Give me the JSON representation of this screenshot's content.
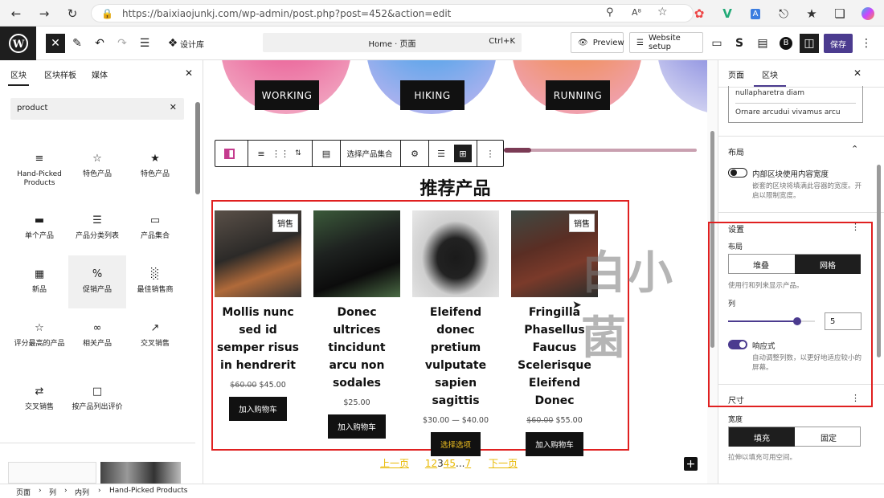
{
  "browser": {
    "url": "https://baixiaojunkj.com/wp-admin/post.php?post=452&action=edit"
  },
  "toolbar": {
    "design_label": "设计库",
    "command_title": "Home · 页面",
    "command_shortcut": "Ctrl+K",
    "preview_label": "Preview",
    "website_setup_label": "Website setup",
    "save_label": "保存"
  },
  "left_panel": {
    "tabs": [
      "区块",
      "区块样板",
      "媒体"
    ],
    "search_value": "product",
    "blocks": [
      {
        "label": "Hand-Picked Products",
        "icon": "list-icon"
      },
      {
        "label": "特色产品",
        "icon": "star-outline-icon"
      },
      {
        "label": "特色产品",
        "icon": "star-filled-icon"
      },
      {
        "label": "单个产品",
        "icon": "single-product-icon"
      },
      {
        "label": "产品分类列表",
        "icon": "category-list-icon"
      },
      {
        "label": "产品集合",
        "icon": "collection-icon"
      },
      {
        "label": "新品",
        "icon": "calendar-icon"
      },
      {
        "label": "促销产品",
        "icon": "percent-icon"
      },
      {
        "label": "最佳销售商",
        "icon": "bar-chart-icon"
      },
      {
        "label": "评分最高的产品",
        "icon": "star-outline-icon"
      },
      {
        "label": "相关产品",
        "icon": "link-icon"
      },
      {
        "label": "交叉销售",
        "icon": "trending-icon"
      },
      {
        "label": "交叉销售",
        "icon": "repeat-icon"
      },
      {
        "label": "按产品列出评价",
        "icon": "comment-icon"
      }
    ]
  },
  "canvas": {
    "categories": [
      "WORKING",
      "HIKING",
      "RUNNING"
    ],
    "toolbar_select_label": "选择产品集合",
    "heading": "推荐产品",
    "watermark": "白小菌",
    "products": [
      {
        "name": "Mollis nunc sed id semper risus in hendrerit",
        "old_price": "$60.00",
        "price": "$45.00",
        "button": "加入购物车",
        "sale": "销售"
      },
      {
        "name": "Donec ultrices tincidunt arcu non sodales",
        "old_price": "",
        "price": "$25.00",
        "button": "加入购物车",
        "sale": ""
      },
      {
        "name": "Eleifend donec pretium vulputate sapien sagittis",
        "old_price": "",
        "price": "$30.00 — $40.00",
        "button": "选择选项",
        "sale": ""
      },
      {
        "name": "Fringilla Phasellus Faucus Scelerisque Eleifend Donec",
        "old_price": "$60.00",
        "price": "$55.00",
        "button": "加入购物车",
        "sale": "销售"
      }
    ],
    "pagination": {
      "prev": "上一页",
      "pages_before": "12",
      "current": "3",
      "pages_after": "45",
      "ellipsis": "...",
      "last": "7",
      "next": "下一页"
    }
  },
  "right_panel": {
    "tabs": [
      "页面",
      "区块"
    ],
    "text_lines": [
      "nullapharetra diam",
      "Ornare arcudui vivamus arcu"
    ],
    "layout_title": "布局",
    "inner_toggle_label": "内部区块使用内容宽度",
    "inner_toggle_hint": "嵌套的区块将填满此容器的宽度。开启以限制宽度。",
    "settings_title": "设置",
    "layout_label": "布局",
    "layout_options": [
      "堆叠",
      "网格"
    ],
    "layout_selected": "网格",
    "layout_hint": "使用行和列来显示产品。",
    "columns_label": "列",
    "columns_value": "5",
    "columns_slider_fraction": 0.8,
    "responsive_label": "响应式",
    "responsive_hint": "自动调整列数，以更好地适应较小的屏幕。",
    "size_title": "尺寸",
    "width_label": "宽度",
    "width_options": [
      "填充",
      "固定"
    ],
    "width_selected": "填充",
    "width_hint": "拉伸以填充可用空间。"
  },
  "breadcrumb": [
    "页面",
    "列",
    "内列",
    "Hand-Picked Products"
  ],
  "colors": {
    "accent": "#4b3b8f",
    "highlight": "#e02020",
    "pagination": "#e8b800"
  }
}
